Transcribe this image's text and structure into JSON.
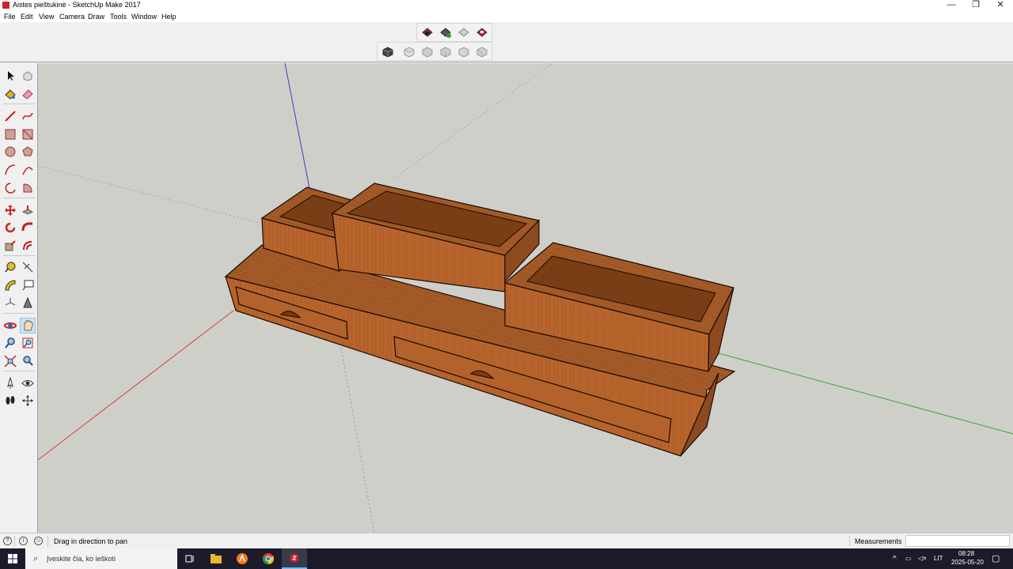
{
  "window": {
    "title": "Aistes pieštukinė - SketchUp Make 2017",
    "controls": [
      "—",
      "❐",
      "✕"
    ]
  },
  "menu": [
    "File",
    "Edit",
    "View",
    "Camera",
    "Draw",
    "Tools",
    "Window",
    "Help"
  ],
  "toolbars": {
    "top_row": [
      "warehouse-icon",
      "get-models-icon",
      "share-model-icon",
      "extension-warehouse-icon"
    ],
    "second_row": [
      "iso-view-icon",
      "top-view-icon",
      "front-view-icon",
      "right-view-icon",
      "back-view-icon",
      "left-view-icon"
    ]
  },
  "left_tools": [
    "select-icon",
    "make-component-icon",
    "paint-bucket-icon",
    "eraser-icon",
    "line-icon",
    "freehand-icon",
    "rectangle-icon",
    "rotated-rectangle-icon",
    "circle-icon",
    "polygon-icon",
    "arc-icon",
    "two-point-arc-icon",
    "three-point-arc-icon",
    "pie-icon",
    "move-icon",
    "push-pull-icon",
    "rotate-icon",
    "follow-me-icon",
    "scale-icon",
    "offset-icon",
    "tape-measure-icon",
    "dimension-icon",
    "protractor-icon",
    "text-icon",
    "axes-icon",
    "3d-text-icon",
    "orbit-icon",
    "pan-icon",
    "zoom-icon",
    "zoom-window-icon",
    "zoom-extents-icon",
    "previous-view-icon",
    "position-camera-icon",
    "look-around-icon",
    "walk-icon",
    "section-plane-icon"
  ],
  "status": {
    "message": "Drag in direction to pan",
    "measurements_label": "Measurements",
    "measurements_value": ""
  },
  "taskbar": {
    "search_placeholder": "Įveskite čia, ko ieškoti",
    "apps": [
      "task-view-icon",
      "file-explorer-icon",
      "app-orange-icon",
      "chrome-icon",
      "sketchup-icon"
    ],
    "language": "LIT",
    "time": "08:28",
    "date": "2025-05-20"
  },
  "colors": {
    "viewport_bg": "#cfcfca",
    "wood_top": "#a35a28",
    "wood_front": "#b8652c",
    "wood_side": "#8d4a1e",
    "axis_red": "#d04040",
    "axis_green": "#3aa33a",
    "axis_blue": "#3a3ad0",
    "accent": "#d0202a"
  }
}
